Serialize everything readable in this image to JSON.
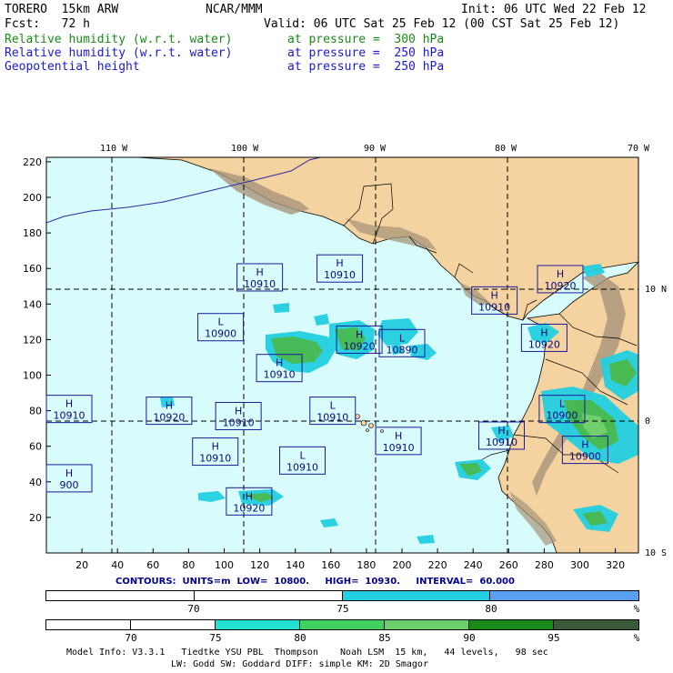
{
  "header": {
    "model": "TORERO  15km ARW",
    "center": "NCAR/MMM",
    "init": "Init: 06 UTC Wed 22 Feb 12",
    "fcst": "Fcst:   72 h",
    "valid": "Valid: 06 UTC Sat 25 Feb 12 (00 CST Sat 25 Feb 12)",
    "fields": [
      {
        "name": "Relative humidity (w.r.t. water)",
        "level": "at pressure =  300 hPa",
        "color": "#1a8a1a"
      },
      {
        "name": "Relative humidity (w.r.t. water)",
        "level": "at pressure =  250 hPa",
        "color": "#1a1acc"
      },
      {
        "name": "Geopotential height",
        "level": "at pressure =  250 hPa",
        "color": "#000000"
      }
    ]
  },
  "map": {
    "lon_labels": [
      "110 W",
      "100 W",
      "90 W",
      "80 W",
      "70 W"
    ],
    "lat_labels": [
      "10 N",
      "0",
      "10 S"
    ],
    "y_ticks": [
      "220",
      "200",
      "180",
      "160",
      "140",
      "120",
      "100",
      "80",
      "60",
      "40",
      "20"
    ],
    "x_ticks": [
      "20",
      "40",
      "60",
      "80",
      "100",
      "120",
      "140",
      "160",
      "180",
      "200",
      "220",
      "240",
      "260",
      "280",
      "300",
      "320"
    ],
    "colors": {
      "ocean": "#d8fbfb",
      "land": "#f5d3a0",
      "mountains": "#a8957a",
      "rh75": "#23cfe0",
      "rh80": "#3fb84f",
      "rh85": "#6ccf6c"
    },
    "centers": [
      {
        "type": "H",
        "value": "10910",
        "gx": 120,
        "gy": 155
      },
      {
        "type": "H",
        "value": "10910",
        "gx": 165,
        "gy": 160
      },
      {
        "type": "L",
        "value": "10900",
        "gx": 98,
        "gy": 127
      },
      {
        "type": "H",
        "value": "10920",
        "gx": 176,
        "gy": 120
      },
      {
        "type": "L",
        "value": "10890",
        "gx": 200,
        "gy": 118
      },
      {
        "type": "H",
        "value": "10910",
        "gx": 131,
        "gy": 104
      },
      {
        "type": "H",
        "value": "10910",
        "gx": 252,
        "gy": 142
      },
      {
        "type": "H",
        "value": "10920",
        "gx": 289,
        "gy": 154
      },
      {
        "type": "H",
        "value": "10920",
        "gx": 280,
        "gy": 121
      },
      {
        "type": "H",
        "value": "10910",
        "gx": 5,
        "gy": 81
      },
      {
        "type": "H",
        "value": "10920",
        "gx": 69,
        "gy": 80
      },
      {
        "type": "H",
        "value": "10910",
        "gx": 108,
        "gy": 77
      },
      {
        "type": "L",
        "value": "10910",
        "gx": 161,
        "gy": 80
      },
      {
        "type": "L",
        "value": "10900",
        "gx": 290,
        "gy": 81
      },
      {
        "type": "H",
        "value": "10910",
        "gx": 95,
        "gy": 57
      },
      {
        "type": "L",
        "value": "10910",
        "gx": 144,
        "gy": 52
      },
      {
        "type": "H",
        "value": "10910",
        "gx": 198,
        "gy": 63
      },
      {
        "type": "H",
        "value": "10910",
        "gx": 256,
        "gy": 66
      },
      {
        "type": "H",
        "value": "10900",
        "gx": 303,
        "gy": 58
      },
      {
        "type": "H",
        "value": "900",
        "gx": 5,
        "gy": 42
      },
      {
        "type": "H",
        "value": "10920",
        "gx": 114,
        "gy": 29
      }
    ]
  },
  "contours": {
    "text": "CONTOURS:  UNITS=m  LOW=  10800.     HIGH=  10930.     INTERVAL=  60.000"
  },
  "colorbar1": {
    "labels": [
      "70",
      "75",
      "80",
      "%"
    ],
    "colors": [
      "#ffffff",
      "#ffffff",
      "#23cfe0",
      "#5aa0f0"
    ]
  },
  "colorbar2": {
    "labels": [
      "70",
      "75",
      "80",
      "85",
      "90",
      "95",
      "%"
    ],
    "colors": [
      "#ffffff",
      "#ffffff",
      "#ffffff",
      "#23e0d0",
      "#3fd060",
      "#6ccf6c",
      "#2fa02f",
      "#1a8a1a",
      "#3a5a3a"
    ]
  },
  "footer": {
    "line1": "Model Info: V3.3.1   Tiedtke YSU PBL  Thompson    Noah LSM  15 km,   44 levels,   98 sec",
    "line2": "LW: Godd SW: Goddard DIFF: simple KM: 2D Smagor"
  }
}
